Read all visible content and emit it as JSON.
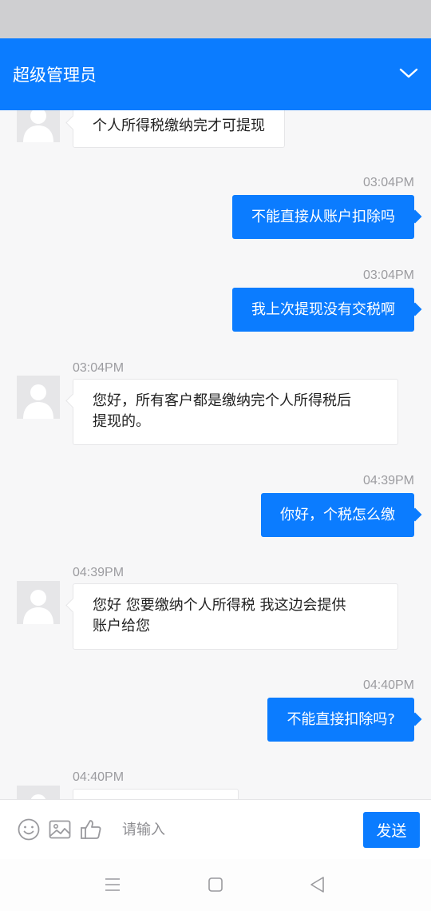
{
  "header": {
    "title": "超级管理员",
    "chevron_icon": "chevron-down-icon"
  },
  "messages": [
    {
      "dir": "in",
      "time": "",
      "text": "个人所得税缴纳完才可提现"
    },
    {
      "dir": "out",
      "time": "03:04PM",
      "text": "不能直接从账户扣除吗"
    },
    {
      "dir": "out",
      "time": "03:04PM",
      "text": "我上次提现没有交税啊"
    },
    {
      "dir": "in",
      "time": "03:04PM",
      "line1": "您好，所有客户都是缴纳完个人所得税后",
      "line2": "提现的。"
    },
    {
      "dir": "out",
      "time": "04:39PM",
      "text": "你好，个税怎么缴"
    },
    {
      "dir": "in",
      "time": "04:39PM",
      "line1": "您好 您要缴纳个人所得税 我这边会提供",
      "line2": "账户给您"
    },
    {
      "dir": "out",
      "time": "04:40PM",
      "text": "不能直接扣除吗?"
    },
    {
      "dir": "in",
      "time": "04:40PM",
      "text": ""
    }
  ],
  "input_bar": {
    "emoji_icon": "emoji-icon",
    "image_icon": "image-icon",
    "thumbs_up_icon": "thumbs-up-icon",
    "placeholder": "请输入",
    "send_label": "发送"
  },
  "nav": {
    "menu_icon": "menu-icon",
    "home_icon": "home-square-icon",
    "back_icon": "back-triangle-icon"
  },
  "colors": {
    "accent": "#0b7cff",
    "background": "#f7f7f8",
    "bubble_in": "#ffffff"
  }
}
